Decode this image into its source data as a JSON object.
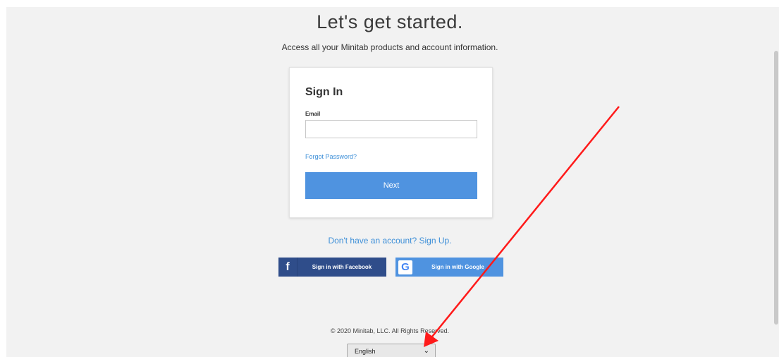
{
  "page": {
    "headline": "Let's get started.",
    "subheadline": "Access all your Minitab products and account information."
  },
  "signin_card": {
    "title": "Sign In",
    "email_label": "Email",
    "email_value": "",
    "email_placeholder": "",
    "forgot_password": "Forgot Password?",
    "next_button": "Next"
  },
  "signup_link": "Don't have an account? Sign Up.",
  "sso": {
    "facebook_icon": "f",
    "facebook_label": "Sign in with Facebook",
    "google_icon": "G",
    "google_label": "Sign in with Google"
  },
  "footer": {
    "copyright": "© 2020 Minitab, LLC. All Rights Reserved.",
    "language_selected": "English"
  },
  "colors": {
    "accent_blue": "#4f93e0",
    "link_blue": "#3d8fd8",
    "facebook_blue": "#2f4d8a",
    "annotation_red": "#ff1a1a",
    "page_background": "#f2f2f2"
  },
  "icons": {
    "facebook": "facebook-icon",
    "google": "google-icon",
    "language_dropdown": "chevron-down-icon",
    "annotation": "red-arrow-annotation"
  }
}
